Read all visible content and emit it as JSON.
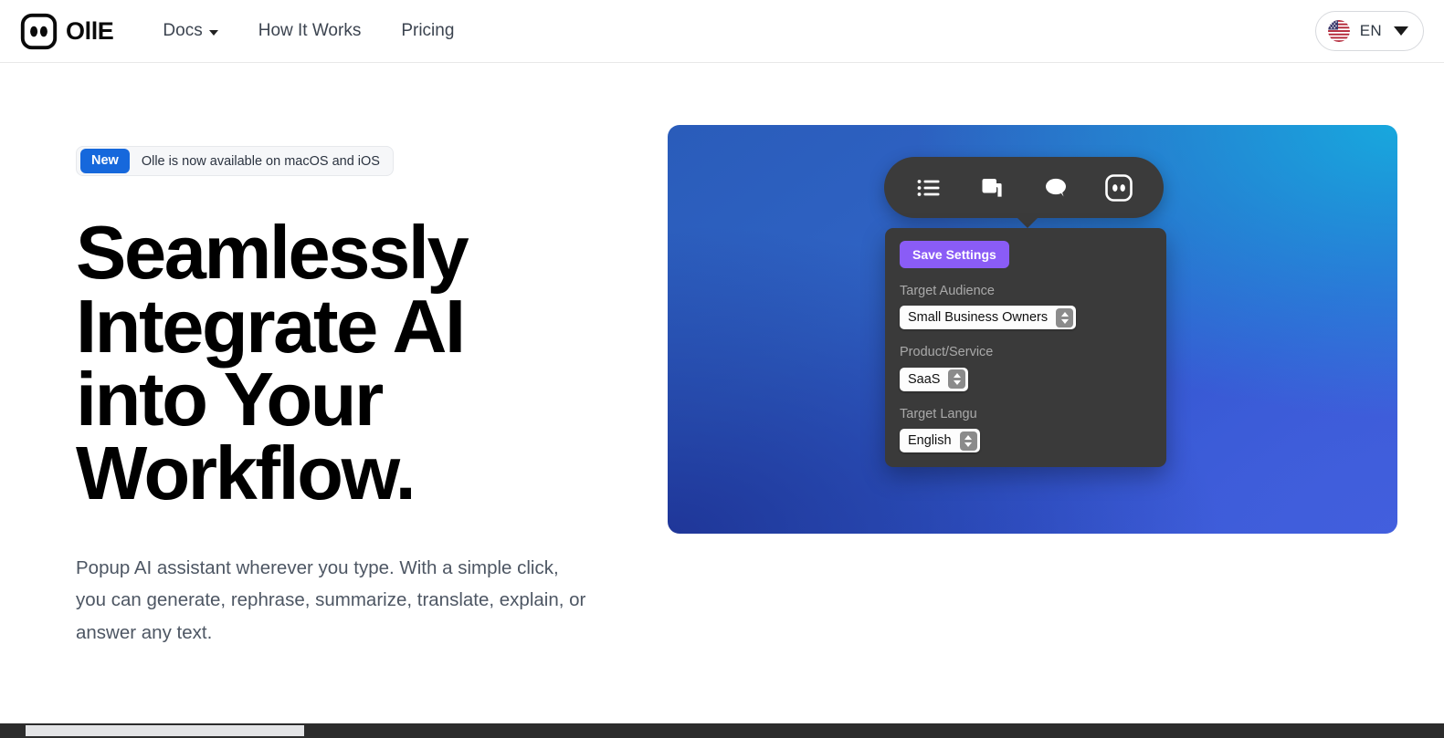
{
  "header": {
    "brand": {
      "name": "OllE",
      "logo_icon": "olle-logo-icon"
    },
    "nav": [
      {
        "label": "Docs",
        "has_dropdown": true,
        "icon": "chevron-down-icon"
      },
      {
        "label": "How It Works",
        "has_dropdown": false
      },
      {
        "label": "Pricing",
        "has_dropdown": false
      }
    ],
    "language_switcher": {
      "flag_icon": "us-flag-icon",
      "label": "EN",
      "chevron_icon": "chevron-down-icon"
    }
  },
  "hero": {
    "announcement": {
      "badge": "New",
      "text": "Olle is now available on macOS and iOS",
      "badge_color": "#1668dc"
    },
    "title": "Seamlessly Integrate AI into Your Workflow.",
    "subtitle": "Popup AI assistant wherever you type. With a simple click, you can generate, rephrase, summarize, translate, explain, or answer any text."
  },
  "showcase": {
    "gradient": {
      "top_left": "#2a5cba",
      "top_right": "#17aade",
      "bottom_left": "#1e3496",
      "bottom_right": "#3e5cd8"
    },
    "toolbar": {
      "background": "#3b3b3b",
      "buttons": [
        {
          "icon": "list-icon",
          "label": "List"
        },
        {
          "icon": "copy-icon",
          "label": "Copy"
        },
        {
          "icon": "chat-bubble-icon",
          "label": "Chat"
        },
        {
          "icon": "olle-logo-icon",
          "label": "Olle"
        }
      ]
    },
    "settings_panel": {
      "background": "#3a3a3a",
      "save_button": {
        "label": "Save Settings",
        "color": "#8a5cf6"
      },
      "fields": [
        {
          "label": "Target Audience",
          "value": "Small Business Owners",
          "truncated": false
        },
        {
          "label": "Product/Service",
          "value": "SaaS",
          "truncated": false
        },
        {
          "label": "Target Langu",
          "value": "English",
          "truncated": true
        }
      ]
    }
  },
  "scrollbar": {
    "orientation": "horizontal",
    "track_color": "#2c2c2c",
    "thumb_color": "#e3e4e6"
  }
}
